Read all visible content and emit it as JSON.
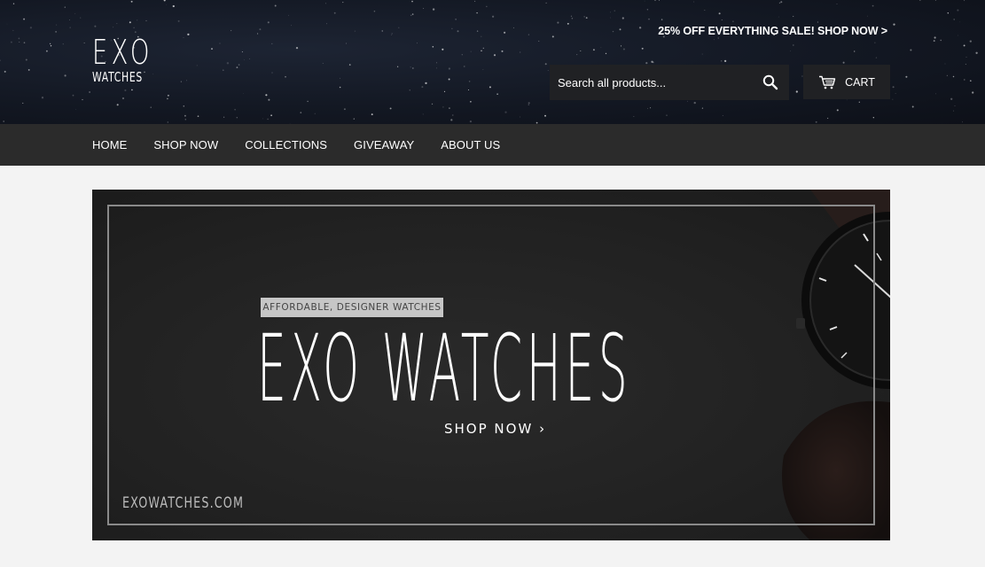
{
  "header": {
    "logo_line1": "EXO",
    "logo_line2": "WATCHES",
    "promo_text": "25% OFF EVERYTHING SALE! SHOP NOW >",
    "search_placeholder": "Search all products...",
    "search_icon": "search-icon",
    "cart_label": "CART",
    "cart_icon": "cart-icon"
  },
  "nav": {
    "items": [
      {
        "label": "HOME"
      },
      {
        "label": "SHOP NOW"
      },
      {
        "label": "COLLECTIONS"
      },
      {
        "label": "GIVEAWAY"
      },
      {
        "label": "ABOUT US"
      }
    ]
  },
  "hero": {
    "tagline": "AFFORDABLE, DESIGNER WATCHES",
    "title": "EXO WATCHES",
    "cta": "SHOP NOW",
    "cta_chevron": "›",
    "url": "EXOWATCHES.COM"
  },
  "colors": {
    "header_bg": "#131823",
    "nav_bg": "#2b2b2b",
    "input_bg": "#202124",
    "page_bg": "#f3f3f3"
  }
}
